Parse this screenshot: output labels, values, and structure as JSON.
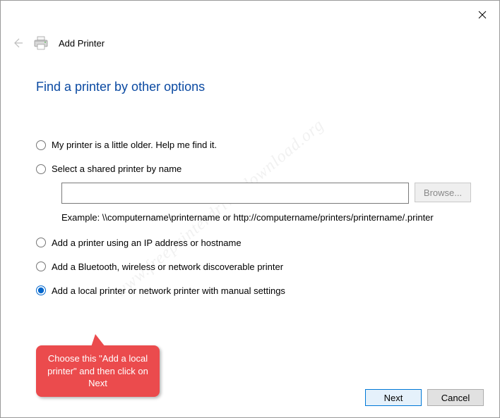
{
  "window": {
    "title": "Add Printer"
  },
  "heading": "Find a printer by other options",
  "options": {
    "older": "My printer is a little older. Help me find it.",
    "shared": "Select a shared printer by name",
    "shared_input_value": "",
    "browse_label": "Browse...",
    "example_text": "Example: \\\\computername\\printername or http://computername/printers/printername/.printer",
    "ip": "Add a printer using an IP address or hostname",
    "bluetooth": "Add a Bluetooth, wireless or network discoverable printer",
    "local": "Add a local printer or network printer with manual settings",
    "selected": "local"
  },
  "callout": {
    "text": "Choose this \"Add a local printer\" and then click on Next"
  },
  "footer": {
    "next": "Next",
    "cancel": "Cancel"
  },
  "watermark": "www.freeprinterdriverdownload.org"
}
